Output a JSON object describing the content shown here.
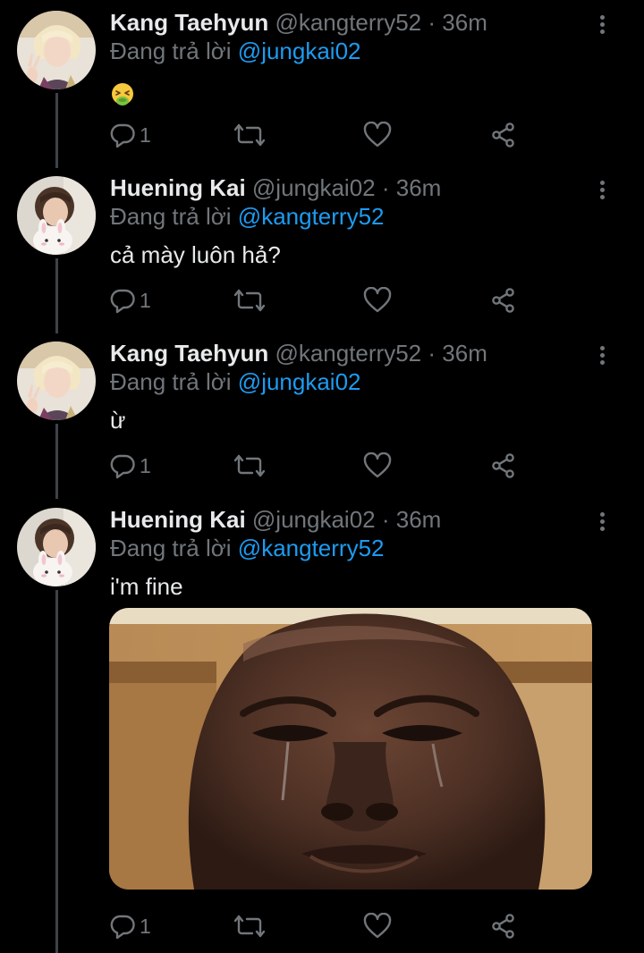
{
  "tweets": [
    {
      "name": "Kang Taehyun",
      "handle": "@kangterry52",
      "separator": "·",
      "time": "36m",
      "reply_prefix": "Đang trả lời",
      "reply_to": "@jungkai02",
      "text": "",
      "emoji": "nauseated-face",
      "reply_count": "1"
    },
    {
      "name": "Huening Kai",
      "handle": "@jungkai02",
      "separator": "·",
      "time": "36m",
      "reply_prefix": "Đang trả lời",
      "reply_to": "@kangterry52",
      "text": "cả mày luôn hả?",
      "reply_count": "1"
    },
    {
      "name": "Kang Taehyun",
      "handle": "@kangterry52",
      "separator": "·",
      "time": "36m",
      "reply_prefix": "Đang trả lời",
      "reply_to": "@jungkai02",
      "text": "ừ",
      "reply_count": "1"
    },
    {
      "name": "Huening Kai",
      "handle": "@jungkai02",
      "separator": "·",
      "time": "36m",
      "reply_prefix": "Đang trả lời",
      "reply_to": "@kangterry52",
      "text": "i'm fine",
      "media": "crying-man-photo",
      "reply_count": "1"
    }
  ],
  "icons": {
    "reply": "reply-icon",
    "retweet": "retweet-icon",
    "like": "heart-icon",
    "share": "share-icon",
    "more": "more-icon"
  },
  "colors": {
    "background": "#000000",
    "text": "#e7e9ea",
    "secondary": "#71767b",
    "mention": "#1d9bf0",
    "thread_line": "#3d4349"
  }
}
